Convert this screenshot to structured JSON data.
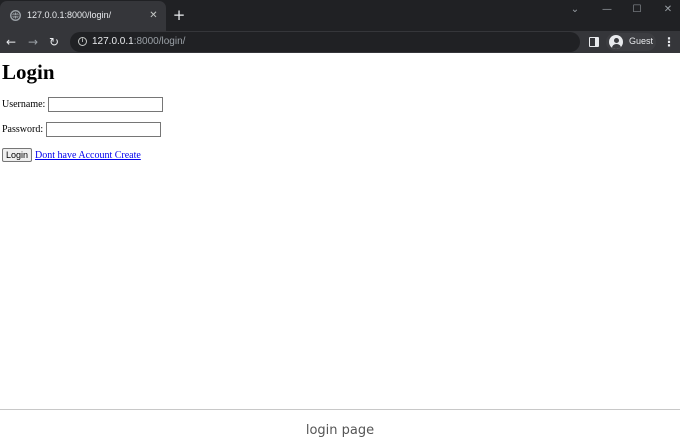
{
  "browser": {
    "tab": {
      "title": "127.0.0.1:8000/login/",
      "favicon": "globe-icon",
      "close_glyph": "✕"
    },
    "new_tab_glyph": "+",
    "window_controls": {
      "tab_search_glyph": "⌄",
      "minimize_glyph": "—",
      "maximize_glyph": "☐",
      "close_glyph": "✕"
    },
    "toolbar": {
      "back_glyph": "←",
      "forward_glyph": "→",
      "reload_glyph": "↻",
      "info_glyph": "i",
      "url_host": "127.0.0.1",
      "url_path": ":8000/login/",
      "profile_name": "Guest",
      "menu_glyph": "⋮"
    },
    "colors": {
      "tabstrip": "#202124",
      "toolbar": "#35363a",
      "omnibox": "#202124"
    }
  },
  "page": {
    "heading": "Login",
    "username": {
      "label": "Username:",
      "value": ""
    },
    "password": {
      "label": "Password:",
      "value": ""
    },
    "login_button": "Login",
    "create_link": "Dont have Account Create",
    "link_color": "#0000ee"
  },
  "caption": "login page"
}
